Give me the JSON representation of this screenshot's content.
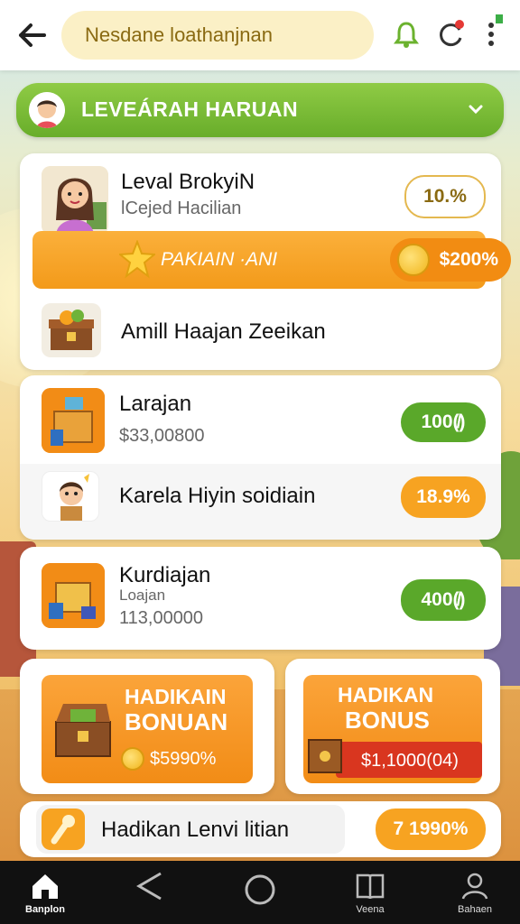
{
  "topbar": {
    "search_text": "Nesdane loathanjnan"
  },
  "level_bar": {
    "title": "LEVEÁRAH HARUAN"
  },
  "card1": {
    "title": "Leval BrokyiN",
    "subtitle": "lCejed Hacilian",
    "percent": "10.%",
    "promo_label": "PAKIAIN ·ANI",
    "promo_amount": "$200%",
    "item_title": "Amill Haajan Zeeikan"
  },
  "card2": {
    "title": "Larajan",
    "subtitle": "$33,00800",
    "percent": "100(̸̸)",
    "row_title": "Karela Hiyin soidiain",
    "row_percent": "18.9%"
  },
  "card3": {
    "title": "Kurdiajan",
    "sub1": "Loajan",
    "sub2": "113,00000",
    "percent": "400(̸̸)"
  },
  "bonus_left": {
    "line1": "HADIKAIN",
    "line2": "BONUAN",
    "amount": "$5990%"
  },
  "bonus_right": {
    "line1": "HADIKAN",
    "line2": "BONUS",
    "amount": "$1,1000(04)"
  },
  "footer_card": {
    "title": "Hadikan Lenvi litian",
    "percent": "7 1990%"
  },
  "bottom_nav": [
    {
      "label": "Banplon",
      "icon": "home-icon"
    },
    {
      "label": "",
      "icon": "share-icon"
    },
    {
      "label": "",
      "icon": "circle-icon"
    },
    {
      "label": "Veena",
      "icon": "book-icon"
    },
    {
      "label": "Bahaen",
      "icon": "user-icon"
    }
  ],
  "colors": {
    "green": "#68ad2a",
    "orange": "#f7a321",
    "topbar": "#ffffff",
    "navbar": "#111111"
  }
}
